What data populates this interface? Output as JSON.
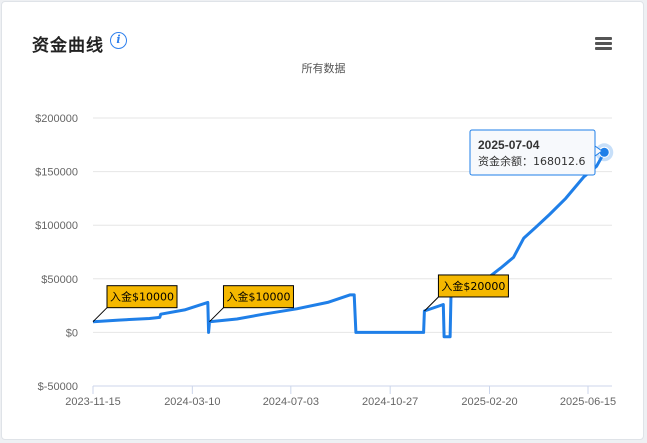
{
  "header": {
    "title": "资金曲线",
    "info_icon": "info-icon",
    "menu_icon": "hamburger-menu-icon"
  },
  "subtitle": "所有数据",
  "colors": {
    "line": "#1f7fe8",
    "flag": "#f5b800",
    "grid": "#e6e6e6"
  },
  "chart_data": {
    "type": "line",
    "title": "资金曲线",
    "subtitle": "所有数据",
    "y_ticks": [
      "$200000",
      "$150000",
      "$100000",
      "$50000",
      "$0",
      "$-50000"
    ],
    "ylim": [
      -50000,
      200000
    ],
    "x_ticks": [
      "2023-11-15",
      "2024-03-10",
      "2024-07-03",
      "2024-10-27",
      "2025-02-20",
      "2025-06-15"
    ],
    "xlim": [
      "2023-11-15",
      "2025-07-04"
    ],
    "grid": true,
    "series": [
      {
        "name": "资金余额",
        "points": [
          [
            "2023-11-15",
            10000
          ],
          [
            "2023-12-15",
            11500
          ],
          [
            "2024-01-20",
            13000
          ],
          [
            "2024-02-01",
            14000
          ],
          [
            "2024-02-02",
            17000
          ],
          [
            "2024-03-01",
            21000
          ],
          [
            "2024-03-28",
            28000
          ],
          [
            "2024-03-29",
            0
          ],
          [
            "2024-03-30",
            10000
          ],
          [
            "2024-05-01",
            12500
          ],
          [
            "2024-06-01",
            17000
          ],
          [
            "2024-07-10",
            22000
          ],
          [
            "2024-08-15",
            28000
          ],
          [
            "2024-09-10",
            35000
          ],
          [
            "2024-09-15",
            35000
          ],
          [
            "2024-09-17",
            0
          ],
          [
            "2024-12-05",
            0
          ],
          [
            "2024-12-06",
            20000
          ],
          [
            "2024-12-28",
            26000
          ],
          [
            "2024-12-29",
            -4000
          ],
          [
            "2025-01-05",
            -4000
          ],
          [
            "2025-01-06",
            35000
          ],
          [
            "2025-01-20",
            40000
          ],
          [
            "2025-02-20",
            52000
          ],
          [
            "2025-03-05",
            60000
          ],
          [
            "2025-03-20",
            70000
          ],
          [
            "2025-04-01",
            88000
          ],
          [
            "2025-04-15",
            98000
          ],
          [
            "2025-05-01",
            110000
          ],
          [
            "2025-05-20",
            125000
          ],
          [
            "2025-06-10",
            145000
          ],
          [
            "2025-06-25",
            155000
          ],
          [
            "2025-07-04",
            168012.6
          ]
        ]
      }
    ],
    "flags": [
      {
        "date": "2023-11-15",
        "value": 10000,
        "label": "入金$10000"
      },
      {
        "date": "2024-03-30",
        "value": 10000,
        "label": "入金$10000"
      },
      {
        "date": "2024-12-06",
        "value": 20000,
        "label": "入金$20000"
      }
    ],
    "tooltip": {
      "date": "2025-07-04",
      "label": "资金余额：",
      "value": "168012.6"
    }
  }
}
